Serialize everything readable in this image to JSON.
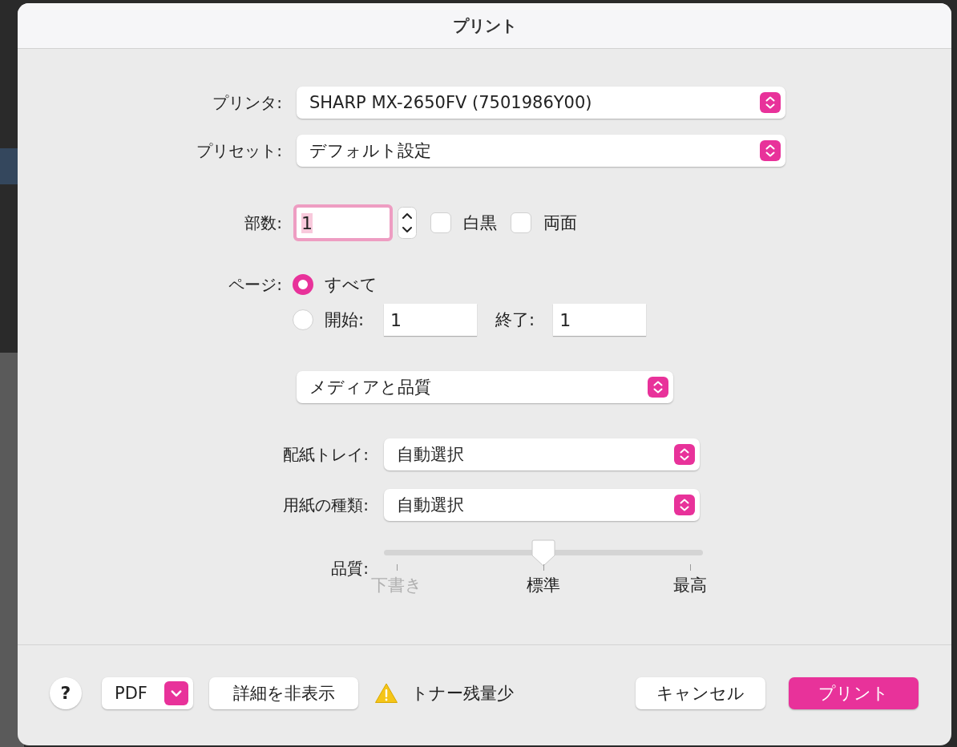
{
  "window": {
    "title": "プリント"
  },
  "printer": {
    "label": "プリンタ:",
    "value": "SHARP MX-2650FV (7501986Y00)"
  },
  "preset": {
    "label": "プリセット:",
    "value": "デフォルト設定"
  },
  "copies": {
    "label": "部数:",
    "value": "1",
    "focused": true
  },
  "options": [
    {
      "label": "白黒",
      "checked": false
    },
    {
      "label": "両面",
      "checked": false
    }
  ],
  "pages": {
    "label": "ページ:",
    "choices": [
      {
        "kind": "all",
        "label": "すべて",
        "selected": true
      },
      {
        "kind": "range",
        "label": "開始:",
        "selected": false,
        "from": "1",
        "to_label": "終了:",
        "to": "1"
      }
    ]
  },
  "panel": {
    "value": "メディアと品質"
  },
  "media": [
    {
      "label": "配紙トレイ:",
      "value": "自動選択"
    },
    {
      "label": "用紙の種類:",
      "value": "自動選択"
    }
  ],
  "quality": {
    "label": "品質:",
    "level": 0.5,
    "stops": [
      {
        "label": "下書き",
        "disabled": true
      },
      {
        "label": "標準",
        "disabled": false
      },
      {
        "label": "最高",
        "disabled": false
      }
    ]
  },
  "footer": {
    "help": "?",
    "pdf": "PDF",
    "details": "詳細を非表示",
    "warning": "トナー残量少",
    "cancel": "キャンセル",
    "print": "プリント"
  }
}
